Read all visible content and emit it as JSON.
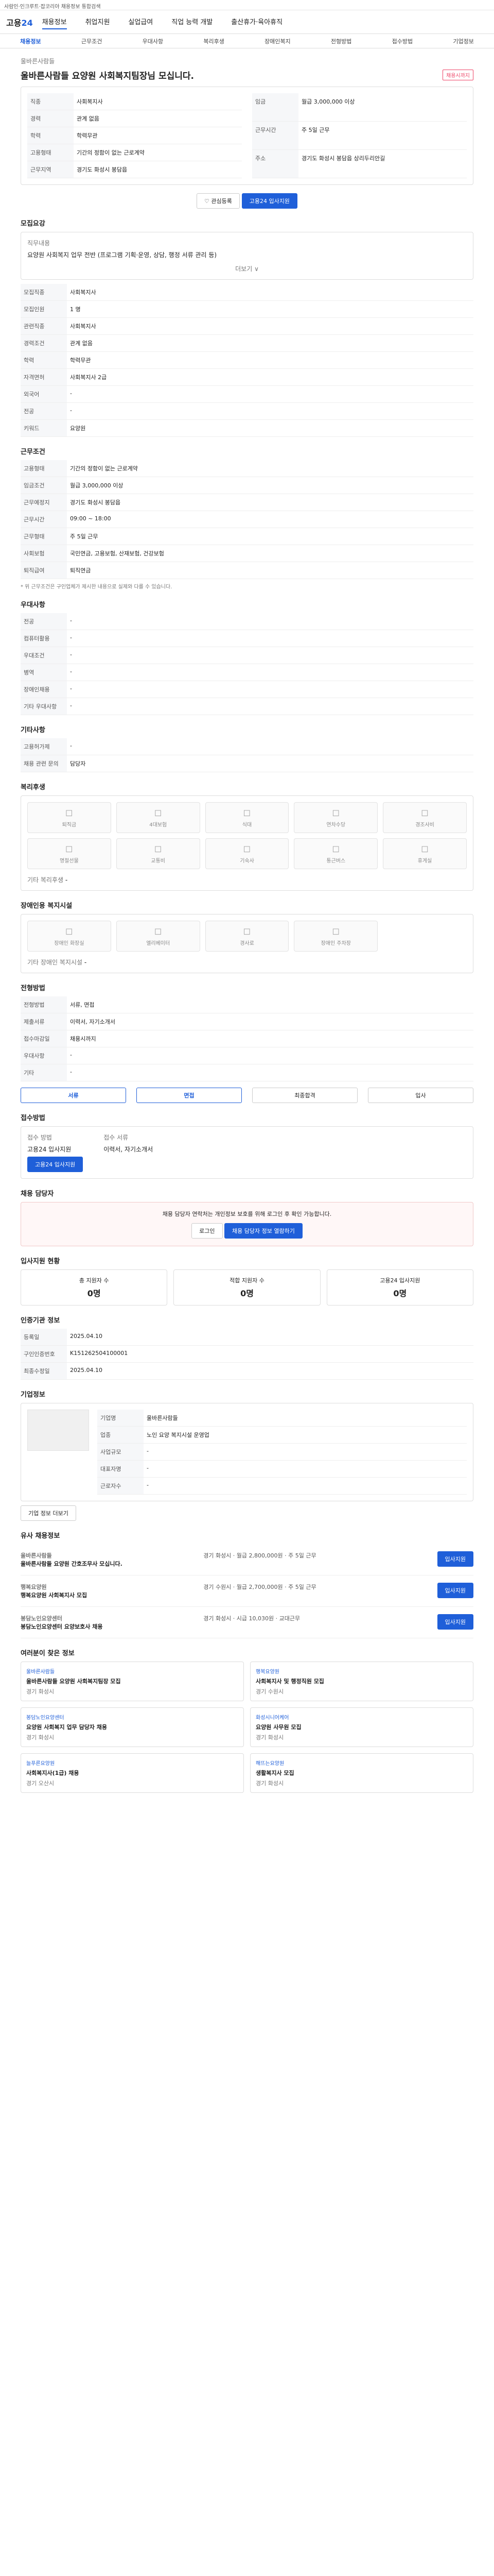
{
  "topbar": {
    "text": "사람인·인크루트·잡코리아 채용정보 통합검색"
  },
  "header": {
    "logo_a": "고용",
    "logo_b": "24",
    "nav": [
      "채용정보",
      "취업지원",
      "실업급여",
      "직업 능력 개발",
      "출산휴가·육아휴직"
    ],
    "nav_active": 0
  },
  "subnav": [
    "채용정보",
    "근무조건",
    "우대사항",
    "복리후생",
    "장애인복지",
    "전형방법",
    "접수방법",
    "기업정보"
  ],
  "job": {
    "company": "울바른사람들",
    "title": "울바른사람들 요양원 사회복지팀장님 모십니다.",
    "deadline_tag": "채용시까지",
    "left": [
      {
        "k": "직종",
        "v": "사회복지사"
      },
      {
        "k": "경력",
        "v": "관계 없음"
      },
      {
        "k": "학력",
        "v": "학력무관"
      },
      {
        "k": "고용형태",
        "v": "기간의 정함이 없는 근로계약"
      },
      {
        "k": "근무지역",
        "v": "경기도 화성시 봉담읍"
      }
    ],
    "right": [
      {
        "k": "임금",
        "v": "월급 3,000,000 이상"
      },
      {
        "k": "근무시간",
        "v": "주 5일 근무"
      },
      {
        "k": "주소",
        "v": "경기도 화성시 봉담읍 상리두리안길"
      }
    ],
    "interest_btn": "관심등록",
    "apply_btn": "고용24 입사지원"
  },
  "sections": {
    "recruit": {
      "title": "모집요강",
      "duty_label": "직무내용",
      "duty": "요양원 사회복지 업무 전반 (프로그램 기획·운영, 상담, 행정 서류 관리 등)",
      "more": "더보기 ∨",
      "rows": [
        {
          "k": "모집직종",
          "v": "사회복지사"
        },
        {
          "k": "모집인원",
          "v": "1 명"
        },
        {
          "k": "관련직종",
          "v": "사회복지사"
        },
        {
          "k": "경력조건",
          "v": "관계 없음"
        },
        {
          "k": "학력",
          "v": "학력무관"
        },
        {
          "k": "자격면허",
          "v": "사회복지사 2급"
        },
        {
          "k": "외국어",
          "v": "-"
        },
        {
          "k": "전공",
          "v": "-"
        },
        {
          "k": "키워드",
          "v": "요양원"
        }
      ]
    },
    "condition": {
      "title": "근무조건",
      "rows": [
        {
          "k": "고용형태",
          "v": "기간의 정함이 없는 근로계약"
        },
        {
          "k": "임금조건",
          "v": "월급 3,000,000 이상"
        },
        {
          "k": "근무예정지",
          "v": "경기도 화성시 봉담읍"
        },
        {
          "k": "근무시간",
          "v": "09:00 ~ 18:00"
        },
        {
          "k": "근무형태",
          "v": "주 5일 근무"
        },
        {
          "k": "사회보험",
          "v": "국민연금, 고용보험, 산재보험, 건강보험"
        },
        {
          "k": "퇴직급여",
          "v": "퇴직연금"
        }
      ],
      "note": "* 위 근무조건은 구인업체가 제시한 내용으로 실제와 다를 수 있습니다."
    },
    "prefer": {
      "title": "우대사항",
      "rows": [
        {
          "k": "전공",
          "v": "-"
        },
        {
          "k": "컴퓨터활용",
          "v": "-"
        },
        {
          "k": "우대조건",
          "v": "-"
        },
        {
          "k": "병역",
          "v": "-"
        },
        {
          "k": "장애인채용",
          "v": "-"
        },
        {
          "k": "기타 우대사항",
          "v": "-"
        }
      ]
    },
    "etc": {
      "title": "기타사항",
      "rows": [
        {
          "k": "고용허가제",
          "v": "-"
        },
        {
          "k": "채용 관련 문의",
          "v": "담당자"
        }
      ]
    },
    "welfare": {
      "title": "복리후생",
      "items": [
        "퇴직금",
        "4대보험",
        "식대",
        "연차수당",
        "경조사비",
        "명절선물",
        "교통비",
        "기숙사",
        "통근버스",
        "휴게실"
      ],
      "etc_label": "기타 복리후생",
      "etc_value": "-"
    },
    "disabled": {
      "title": "장애인용 복지시설",
      "items": [
        "장애인 화장실",
        "엘리베이터",
        "경사로",
        "장애인 주차장"
      ],
      "etc_label": "기타 장애인 복지시설",
      "etc_value": "-"
    },
    "process": {
      "title": "전형방법",
      "rows": [
        {
          "k": "전형방법",
          "v": "서류, 면접"
        },
        {
          "k": "제출서류",
          "v": "이력서, 자기소개서"
        },
        {
          "k": "접수마감일",
          "v": "채용시까지"
        },
        {
          "k": "우대사항",
          "v": "-"
        },
        {
          "k": "기타",
          "v": "-"
        }
      ],
      "steps": [
        "서류",
        "면접",
        "최종합격",
        "입사"
      ]
    },
    "apply": {
      "title": "접수방법",
      "method_label": "접수 방법",
      "method": "고용24 입사지원",
      "doc_label": "접수 서류",
      "doc": "이력서, 자기소개서",
      "btn": "고용24 입사지원"
    },
    "contact": {
      "title": "채용 담당자",
      "notice": "채용 담당자 연락처는 개인정보 보호를 위해 로그인 후 확인 가능합니다.",
      "login": "로그인",
      "btn": "채용 담당자 정보 열람하기"
    },
    "status": {
      "title": "입사지원 현황",
      "items": [
        {
          "k": "총 지원자 수",
          "v": "0명"
        },
        {
          "k": "적합 지원자 수",
          "v": "0명"
        },
        {
          "k": "고용24 입사지원",
          "v": "0명"
        }
      ]
    },
    "info": {
      "title": "인증기관 정보",
      "rows": [
        {
          "k": "등록일",
          "v": "2025.04.10"
        },
        {
          "k": "구인인증번호",
          "v": "K151262504100001"
        },
        {
          "k": "최종수정일",
          "v": "2025.04.10"
        }
      ]
    },
    "company": {
      "title": "기업정보",
      "rows": [
        {
          "k": "기업명",
          "v": "울바른사람들"
        },
        {
          "k": "업종",
          "v": "노인 요양 복지시설 운영업"
        },
        {
          "k": "사업규모",
          "v": "-"
        },
        {
          "k": "대표자명",
          "v": "-"
        },
        {
          "k": "근로자수",
          "v": "-"
        }
      ],
      "btn": "기업 정보 더보기"
    },
    "joblist": {
      "title": "유사 채용정보",
      "items": [
        {
          "co": "울바른사람들",
          "title": "울바른사람들 요양원 간호조무사 모십니다.",
          "meta": "경기 화성시 · 월급 2,800,000원 · 주 5일 근무",
          "btn": "입사지원"
        },
        {
          "co": "행복요양원",
          "title": "행복요양원 사회복지사 모집",
          "meta": "경기 수원시 · 월급 2,700,000원 · 주 5일 근무",
          "btn": "입사지원"
        },
        {
          "co": "봉담노인요양센터",
          "title": "봉담노인요양센터 요양보호사 채용",
          "meta": "경기 화성시 · 시급 10,030원 · 교대근무",
          "btn": "입사지원"
        }
      ]
    },
    "related": {
      "title": "여러분이 찾은 정보",
      "items": [
        {
          "co": "울바른사람들",
          "ti": "울바른사람들 요양원 사회복지팀장 모집",
          "meta": "경기 화성시"
        },
        {
          "co": "행복요양원",
          "ti": "사회복지사 및 행정직원 모집",
          "meta": "경기 수원시"
        },
        {
          "co": "봉담노인요양센터",
          "ti": "요양원 사회복지 업무 담당자 채용",
          "meta": "경기 화성시"
        },
        {
          "co": "화성시니어케어",
          "ti": "요양원 사무원 모집",
          "meta": "경기 화성시"
        },
        {
          "co": "늘푸른요양원",
          "ti": "사회복지사(1급) 채용",
          "meta": "경기 오산시"
        },
        {
          "co": "해뜨는요양원",
          "ti": "생활복지사 모집",
          "meta": "경기 화성시"
        }
      ]
    }
  }
}
